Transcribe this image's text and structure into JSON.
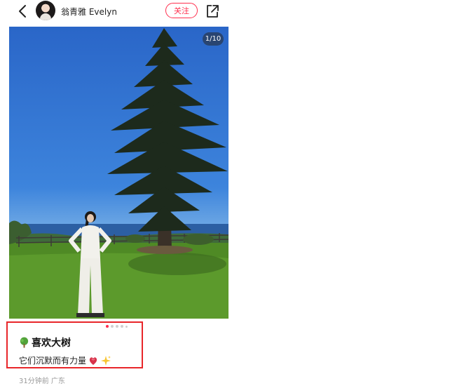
{
  "header": {
    "username": "翁青雅 Evelyn",
    "follow_label": "关注"
  },
  "photo": {
    "counter": "1/10"
  },
  "pagination": {
    "active_index": 0,
    "count": 5
  },
  "post": {
    "title": "喜欢大树",
    "description": "它们沉默而有力量",
    "time": "31分钟前",
    "location": "广东"
  },
  "icons": {
    "back": "back-arrow-icon",
    "share": "share-icon",
    "title_emoji": "tree-emoji",
    "desc_emoji_1": "heart-emoji",
    "desc_emoji_2": "sparkles-emoji"
  },
  "colors": {
    "accent": "#ff2e4d",
    "highlight_box": "#e8262a",
    "sky": "#3d84dc",
    "grass": "#5c9a2c"
  }
}
